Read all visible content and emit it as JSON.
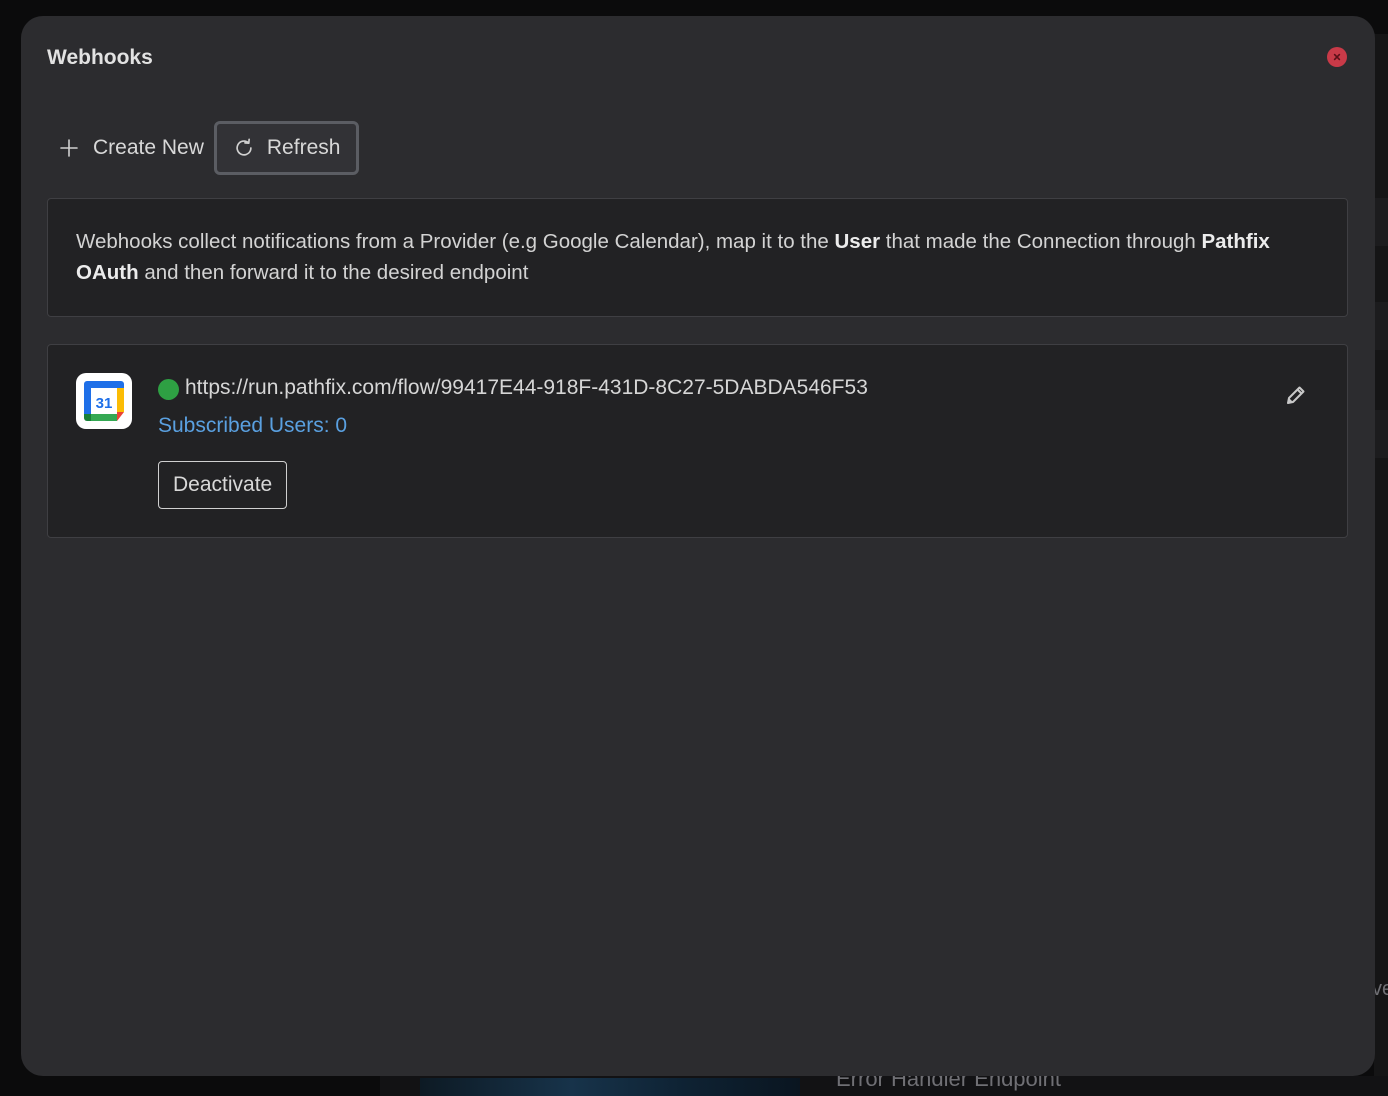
{
  "modal": {
    "title": "Webhooks"
  },
  "toolbar": {
    "create_label": "Create New",
    "refresh_label": "Refresh"
  },
  "info": {
    "text_1": "Webhooks collect notifications from a Provider (e.g Google Calendar), map it to the ",
    "bold_1": "User",
    "text_2": " that made the Connection through ",
    "bold_2": "Pathfix OAuth",
    "text_3": " and then forward it to the desired endpoint"
  },
  "webhooks": [
    {
      "provider_icon": "google-calendar-icon",
      "calendar_day": "31",
      "status": "active",
      "status_color": "#2ea043",
      "url": "https://run.pathfix.com/flow/99417E44-918F-431D-8C27-5DABDA546F53",
      "subscribed_label": "Subscribed Users: 0",
      "deactivate_label": "Deactivate"
    }
  ],
  "background": {
    "partial_text": "Error Handler Endpoint",
    "partial_edge_text": "ve"
  },
  "colors": {
    "accent_link": "#5aa0e0",
    "close": "#c93a48",
    "modal_bg": "#2c2c2f"
  }
}
